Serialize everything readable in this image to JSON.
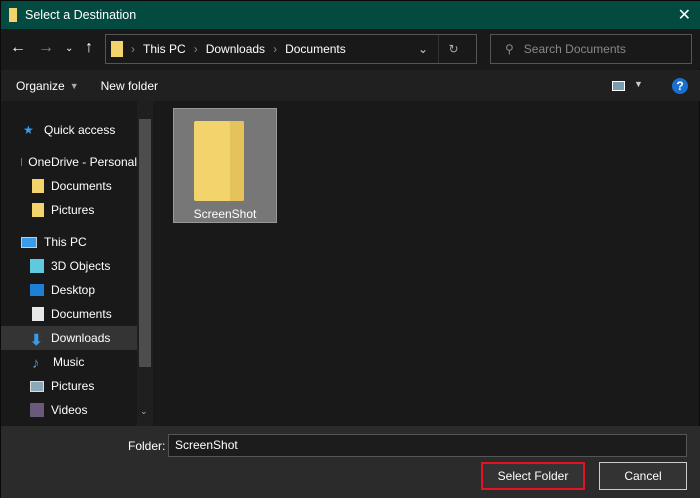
{
  "window": {
    "title": "Select a Destination"
  },
  "address": {
    "crumbs": [
      "This PC",
      "Downloads",
      "Documents"
    ]
  },
  "search": {
    "placeholder": "Search Documents"
  },
  "toolbar": {
    "organize": "Organize",
    "new_folder": "New folder"
  },
  "sidebar": {
    "items": [
      {
        "label": "Quick access",
        "icon": "star-icon"
      },
      {
        "label": "OneDrive - Personal",
        "icon": "cloud-icon"
      },
      {
        "label": "Documents",
        "icon": "folder-icon"
      },
      {
        "label": "Pictures",
        "icon": "folder-icon"
      },
      {
        "label": "This PC",
        "icon": "computer-icon"
      },
      {
        "label": "3D Objects",
        "icon": "cube-icon"
      },
      {
        "label": "Desktop",
        "icon": "desktop-icon"
      },
      {
        "label": "Documents",
        "icon": "document-icon"
      },
      {
        "label": "Downloads",
        "icon": "download-icon"
      },
      {
        "label": "Music",
        "icon": "music-icon"
      },
      {
        "label": "Pictures",
        "icon": "picture-icon"
      },
      {
        "label": "Videos",
        "icon": "video-icon"
      }
    ]
  },
  "files": [
    {
      "name": "ScreenShot"
    }
  ],
  "footer": {
    "folder_label": "Folder:",
    "folder_value": "ScreenShot",
    "select": "Select Folder",
    "cancel": "Cancel"
  },
  "colors": {
    "titlebar": "#034a40",
    "highlight": "#e81123"
  }
}
